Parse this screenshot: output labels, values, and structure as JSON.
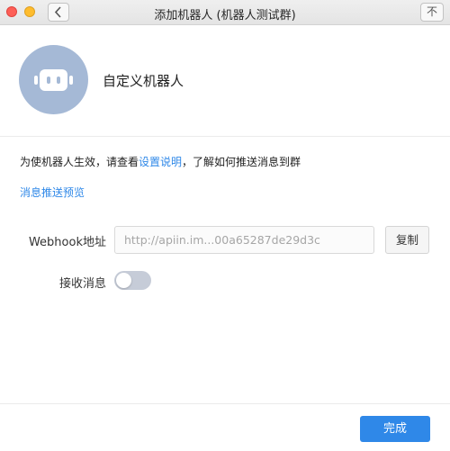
{
  "window": {
    "title": "添加机器人 (机器人测试群)",
    "pin_label": "不"
  },
  "bot": {
    "name": "自定义机器人",
    "avatar_icon": "robot-icon",
    "avatar_color": "#a5b9d6"
  },
  "instructions": {
    "prefix": "为使机器人生效，请查看",
    "link": "设置说明",
    "suffix": "，了解如何推送消息到群"
  },
  "preview_link": "消息推送预览",
  "webhook": {
    "label": "Webhook地址",
    "value": "http://apiin.im...00a65287de29d3c",
    "copy_label": "复制"
  },
  "receive": {
    "label": "接收消息",
    "enabled": false
  },
  "footer": {
    "done_label": "完成"
  },
  "colors": {
    "accent": "#2f88e8"
  }
}
